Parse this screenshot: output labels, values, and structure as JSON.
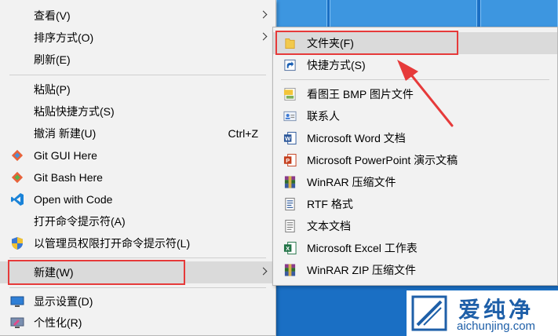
{
  "main_menu": {
    "items": [
      {
        "label": "查看(V)",
        "has_submenu": true
      },
      {
        "label": "排序方式(O)",
        "has_submenu": true
      },
      {
        "label": "刷新(E)"
      },
      {
        "label": "粘贴(P)"
      },
      {
        "label": "粘贴快捷方式(S)"
      },
      {
        "label": "撤消 新建(U)",
        "shortcut": "Ctrl+Z"
      },
      {
        "label": "Git GUI Here",
        "icon": "git-gui-icon"
      },
      {
        "label": "Git Bash Here",
        "icon": "git-bash-icon"
      },
      {
        "label": "Open with Code",
        "icon": "vscode-icon"
      },
      {
        "label": "打开命令提示符(A)"
      },
      {
        "label": "以管理员权限打开命令提示符(L)",
        "icon": "uac-shield-icon"
      },
      {
        "label": "新建(W)",
        "has_submenu": true,
        "highlighted": true
      },
      {
        "label": "显示设置(D)",
        "icon": "display-settings-icon"
      },
      {
        "label": "个性化(R)",
        "icon": "personalize-icon"
      }
    ]
  },
  "new_submenu": {
    "items": [
      {
        "label": "文件夹(F)",
        "icon": "folder-icon",
        "highlighted": true
      },
      {
        "label": "快捷方式(S)",
        "icon": "shortcut-icon"
      },
      {
        "label": "看图王 BMP 图片文件",
        "icon": "bmp-image-icon"
      },
      {
        "label": "联系人",
        "icon": "contact-icon"
      },
      {
        "label": "Microsoft Word 文档",
        "icon": "word-icon"
      },
      {
        "label": "Microsoft PowerPoint 演示文稿",
        "icon": "powerpoint-icon"
      },
      {
        "label": "WinRAR 压缩文件",
        "icon": "winrar-icon"
      },
      {
        "label": "RTF 格式",
        "icon": "rtf-icon"
      },
      {
        "label": "文本文档",
        "icon": "text-doc-icon"
      },
      {
        "label": "Microsoft Excel 工作表",
        "icon": "excel-icon"
      },
      {
        "label": "WinRAR ZIP 压缩文件",
        "icon": "winrar-zip-icon"
      }
    ]
  },
  "watermark": {
    "title": "爱纯净",
    "url": "aichunjing.com"
  },
  "colors": {
    "annotation_red": "#e63a3a",
    "highlight": "#dadada",
    "menu_bg": "#f2f2f2",
    "desktop_blue": "#1a6fc4",
    "watermark_blue": "#1e5fa8"
  }
}
